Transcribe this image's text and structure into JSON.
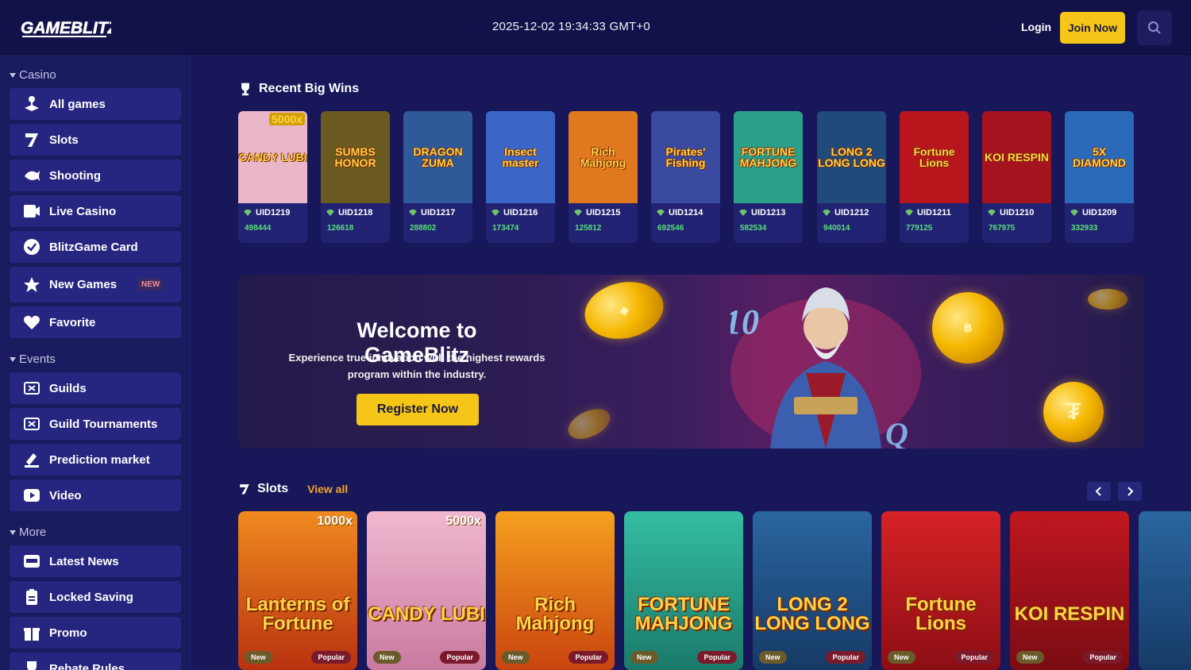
{
  "header": {
    "logo_text": "GAMEBLITZ",
    "datetime": "2025-12-02 19:34:33 GMT+0",
    "login_label": "Login",
    "join_label": "Join Now",
    "search_icon": "search-icon"
  },
  "sidebar": {
    "casino_title": "Casino",
    "casino_items": [
      {
        "label": "All games",
        "icon": "joystick-icon"
      },
      {
        "label": "Slots",
        "icon": "slot-seven-icon"
      },
      {
        "label": "Shooting",
        "icon": "fish-icon"
      },
      {
        "label": "Live Casino",
        "icon": "camera-icon"
      },
      {
        "label": "BlitzGame Card",
        "icon": "check-circle-icon"
      },
      {
        "label": "New Games",
        "icon": "star-icon",
        "badge": "NEW"
      },
      {
        "label": "Favorite",
        "icon": "heart-icon"
      }
    ],
    "events_title": "Events",
    "events_items": [
      {
        "label": "Guilds",
        "icon": "ticket-icon"
      },
      {
        "label": "Guild Tournaments",
        "icon": "ticket-icon"
      },
      {
        "label": "Prediction market",
        "icon": "pen-icon"
      },
      {
        "label": "Video",
        "icon": "play-icon"
      }
    ],
    "more_title": "More",
    "more_items": [
      {
        "label": "Latest News",
        "icon": "news-icon"
      },
      {
        "label": "Locked Saving",
        "icon": "clipboard-icon"
      },
      {
        "label": "Promo",
        "icon": "gift-icon"
      },
      {
        "label": "Rebate Rules",
        "icon": "trophy-icon"
      }
    ]
  },
  "recent_wins": {
    "title": "Recent Big Wins",
    "items": [
      {
        "game": "CANDY LUBI",
        "tag": "5000x",
        "uid": "UID1219",
        "amount": "498444",
        "color": "#e9b7c8"
      },
      {
        "game": "SUMBS HONOR",
        "uid": "UID1218",
        "amount": "126618",
        "color": "#6b5a1f"
      },
      {
        "game": "DRAGON ZUMA",
        "uid": "UID1217",
        "amount": "288802",
        "color": "#2f5a9a"
      },
      {
        "game": "Insect master",
        "uid": "UID1216",
        "amount": "173474",
        "color": "#3a66c8"
      },
      {
        "game": "Rich Mahjong",
        "uid": "UID1215",
        "amount": "125812",
        "color": "#e0781f"
      },
      {
        "game": "Pirates' Fishing",
        "uid": "UID1214",
        "amount": "692546",
        "color": "#3a4aa0"
      },
      {
        "game": "FORTUNE MAHJONG",
        "uid": "UID1213",
        "amount": "582534",
        "color": "#2aa08a"
      },
      {
        "game": "LONG 2 LONG LONG",
        "uid": "UID1212",
        "amount": "940014",
        "color": "#1f4a7a"
      },
      {
        "game": "Fortune Lions",
        "uid": "UID1211",
        "amount": "779125",
        "color": "#b8161c"
      },
      {
        "game": "KOI RESPIN",
        "uid": "UID1210",
        "amount": "767975",
        "color": "#a5141e"
      },
      {
        "game": "5X DIAMOND",
        "uid": "UID1209",
        "amount": "332933",
        "color": "#2a6ab8"
      }
    ]
  },
  "banner": {
    "title": "Welcome to GameBlitz",
    "description": "Experience true innovation with the highest rewards program within the industry.",
    "button_label": "Register Now"
  },
  "slots": {
    "title": "Slots",
    "view_all": "View all",
    "prev_icon": "chevron-left-icon",
    "next_icon": "chevron-right-icon",
    "items": [
      {
        "game": "Lanterns of Fortune",
        "mult": "1000x",
        "new": "New",
        "popular": "Popular",
        "color": "#d2481a"
      },
      {
        "game": "CANDY LUBI",
        "mult": "5000x",
        "new": "New",
        "popular": "Popular",
        "color": "#e6a8c4"
      },
      {
        "game": "Rich Mahjong",
        "new": "New",
        "popular": "Popular",
        "color": "#e8751a"
      },
      {
        "game": "FORTUNE MAHJONG",
        "new": "New",
        "popular": "Popular",
        "color": "#2aa58e"
      },
      {
        "game": "LONG 2 LONG LONG",
        "new": "New",
        "popular": "Popular",
        "color": "#1f4f84"
      },
      {
        "game": "Fortune Lions",
        "new": "New",
        "popular": "Popular",
        "color": "#be1a1e"
      },
      {
        "game": "KOI RESPIN",
        "new": "New",
        "popular": "Popular",
        "color": "#a3121c"
      }
    ]
  },
  "colors": {
    "accent": "#f5c518",
    "background": "#17175a",
    "sidebar_item": "#262680",
    "amount_green": "#57e07a",
    "view_all": "#f5a623"
  }
}
